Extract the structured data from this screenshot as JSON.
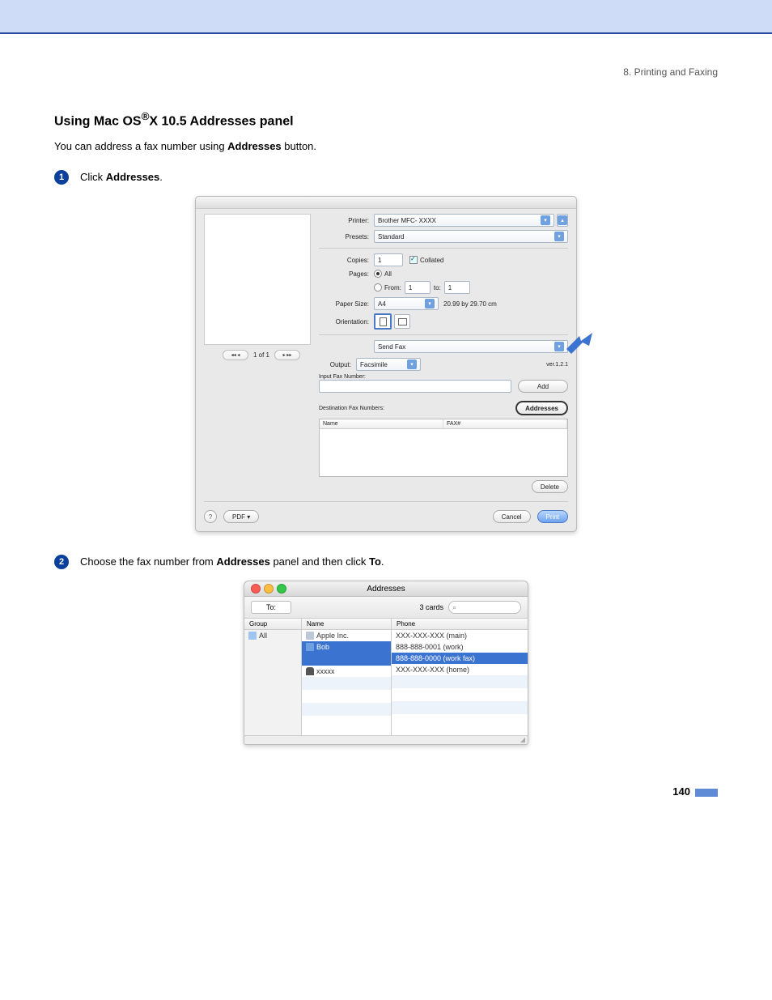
{
  "header": {
    "section": "8. Printing and Faxing"
  },
  "title_parts": {
    "prefix": "Using Mac OS",
    "suffix": "X 10.5 Addresses panel"
  },
  "intro_parts": {
    "a": "You can address a fax number using ",
    "b": "Addresses",
    "c": " button."
  },
  "steps": {
    "s1": {
      "num": "1",
      "a": "Click ",
      "b": "Addresses",
      "c": "."
    },
    "s2": {
      "num": "2",
      "a": "Choose the fax number from ",
      "b": "Addresses",
      "c": " panel and then click ",
      "d": "To",
      "e": "."
    }
  },
  "print_dialog": {
    "labels": {
      "printer": "Printer:",
      "presets": "Presets:",
      "copies": "Copies:",
      "pages": "Pages:",
      "paper_size": "Paper Size:",
      "orientation": "Orientation:",
      "output": "Output:",
      "input_fax": "Input Fax Number:",
      "dest_fax": "Destination Fax Numbers:",
      "from": "From:",
      "to": "to:"
    },
    "values": {
      "printer": "Brother MFC- XXXX",
      "presets": "Standard",
      "copies": "1",
      "collated": "Collated",
      "pages_all": "All",
      "from": "1",
      "to_v": "1",
      "paper_size": "A4",
      "paper_dim": "20.99 by 29.70 cm",
      "panel": "Send Fax",
      "output": "Facsimile",
      "version": "ver.1.2.1",
      "nav": "1 of 1"
    },
    "buttons": {
      "add": "Add",
      "addresses": "Addresses",
      "delete": "Delete",
      "pdf": "PDF ▾",
      "cancel": "Cancel",
      "print": "Print"
    },
    "table_headers": {
      "name": "Name",
      "fax": "FAX#"
    }
  },
  "addresses_panel": {
    "title": "Addresses",
    "to_button": "To:",
    "card_count": "3 cards",
    "columns": {
      "group": "Group",
      "name": "Name",
      "phone": "Phone"
    },
    "groups": {
      "all": "All"
    },
    "names": {
      "n1": "Apple Inc.",
      "n2": "Bob",
      "n3": "xxxxx"
    },
    "phones": {
      "p1": "XXX-XXX-XXX  (main)",
      "p2": "888-888-0001  (work)",
      "p3": "888-888-0000  (work fax)",
      "p4": "XXX-XXX-XXX  (home)"
    }
  },
  "page_number": "140"
}
